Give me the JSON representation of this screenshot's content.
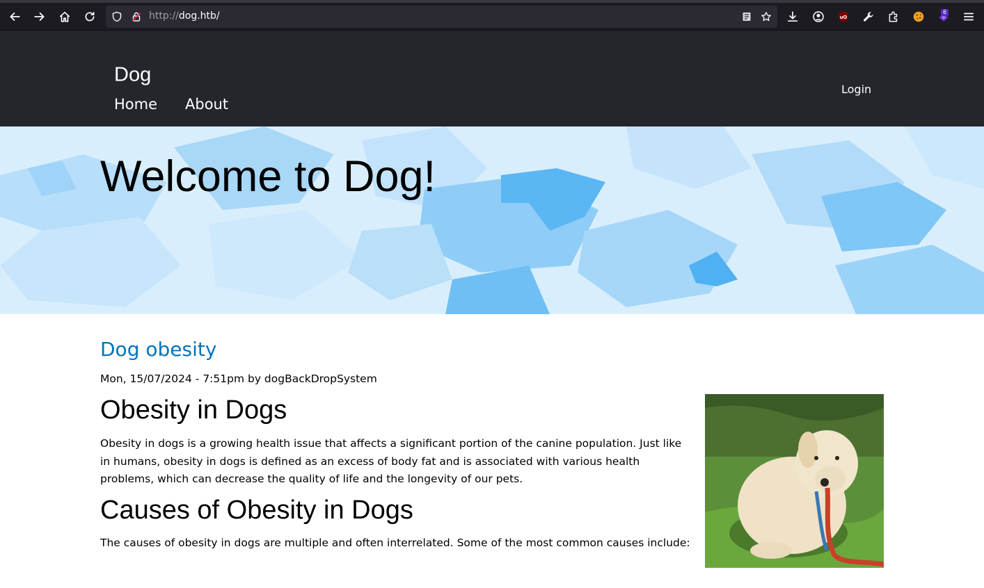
{
  "browser": {
    "url_protocol": "http://",
    "url_host": "dog.htb/",
    "extension_badge": "6"
  },
  "site": {
    "logo": "Dog",
    "login": "Login",
    "nav": [
      {
        "label": "Home"
      },
      {
        "label": "About"
      }
    ]
  },
  "hero": {
    "title": "Welcome to Dog!"
  },
  "article": {
    "title": "Dog obesity",
    "meta": "Mon, 15/07/2024 - 7:51pm by dogBackDropSystem",
    "section1_heading": "Obesity in Dogs",
    "section1_text": "Obesity in dogs is a growing health issue that affects a significant portion of the canine population. Just like in humans, obesity in dogs is defined as an excess of body fat and is associated with various health problems, which can decrease the quality of life and the longevity of our pets.",
    "section2_heading": "Causes of Obesity in Dogs",
    "section2_text": "The causes of obesity in dogs are multiple and often interrelated. Some of the most common causes include:"
  }
}
